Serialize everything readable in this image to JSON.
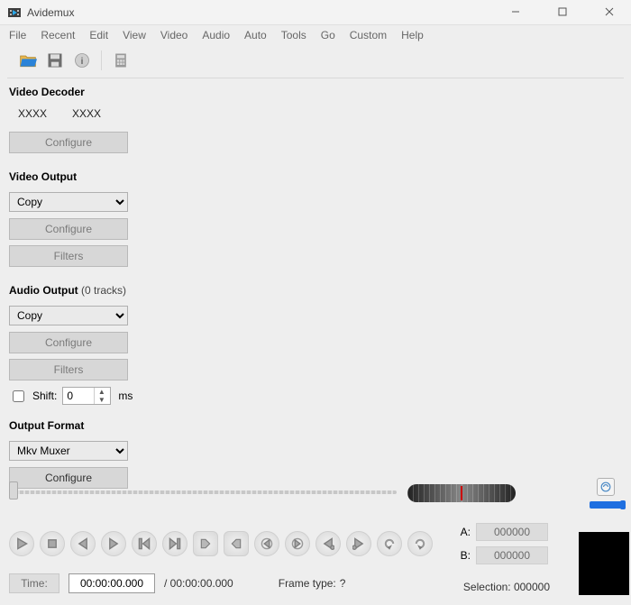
{
  "title": "Avidemux",
  "menu": [
    "File",
    "Recent",
    "Edit",
    "View",
    "Video",
    "Audio",
    "Auto",
    "Tools",
    "Go",
    "Custom",
    "Help"
  ],
  "sections": {
    "decoder": {
      "title": "Video Decoder",
      "x1": "XXXX",
      "x2": "XXXX",
      "configure": "Configure"
    },
    "vout": {
      "title": "Video Output",
      "selected": "Copy",
      "configure": "Configure",
      "filters": "Filters"
    },
    "aout": {
      "title": "Audio Output",
      "tracks_suffix": "(0 tracks)",
      "selected": "Copy",
      "configure": "Configure",
      "filters": "Filters",
      "shift_label": "Shift:",
      "shift_value": "0",
      "shift_unit": "ms"
    },
    "format": {
      "title": "Output Format",
      "selected": "Mkv Muxer",
      "configure": "Configure"
    }
  },
  "ab": {
    "a_label": "A:",
    "b_label": "B:",
    "a_value": "000000",
    "b_value": "000000"
  },
  "timebar": {
    "time_btn": "Time:",
    "current": "00:00:00.000",
    "total": "/ 00:00:00.000",
    "frame_label": "Frame type:",
    "frame_value": "?",
    "selection_label": "Selection: 000000"
  }
}
